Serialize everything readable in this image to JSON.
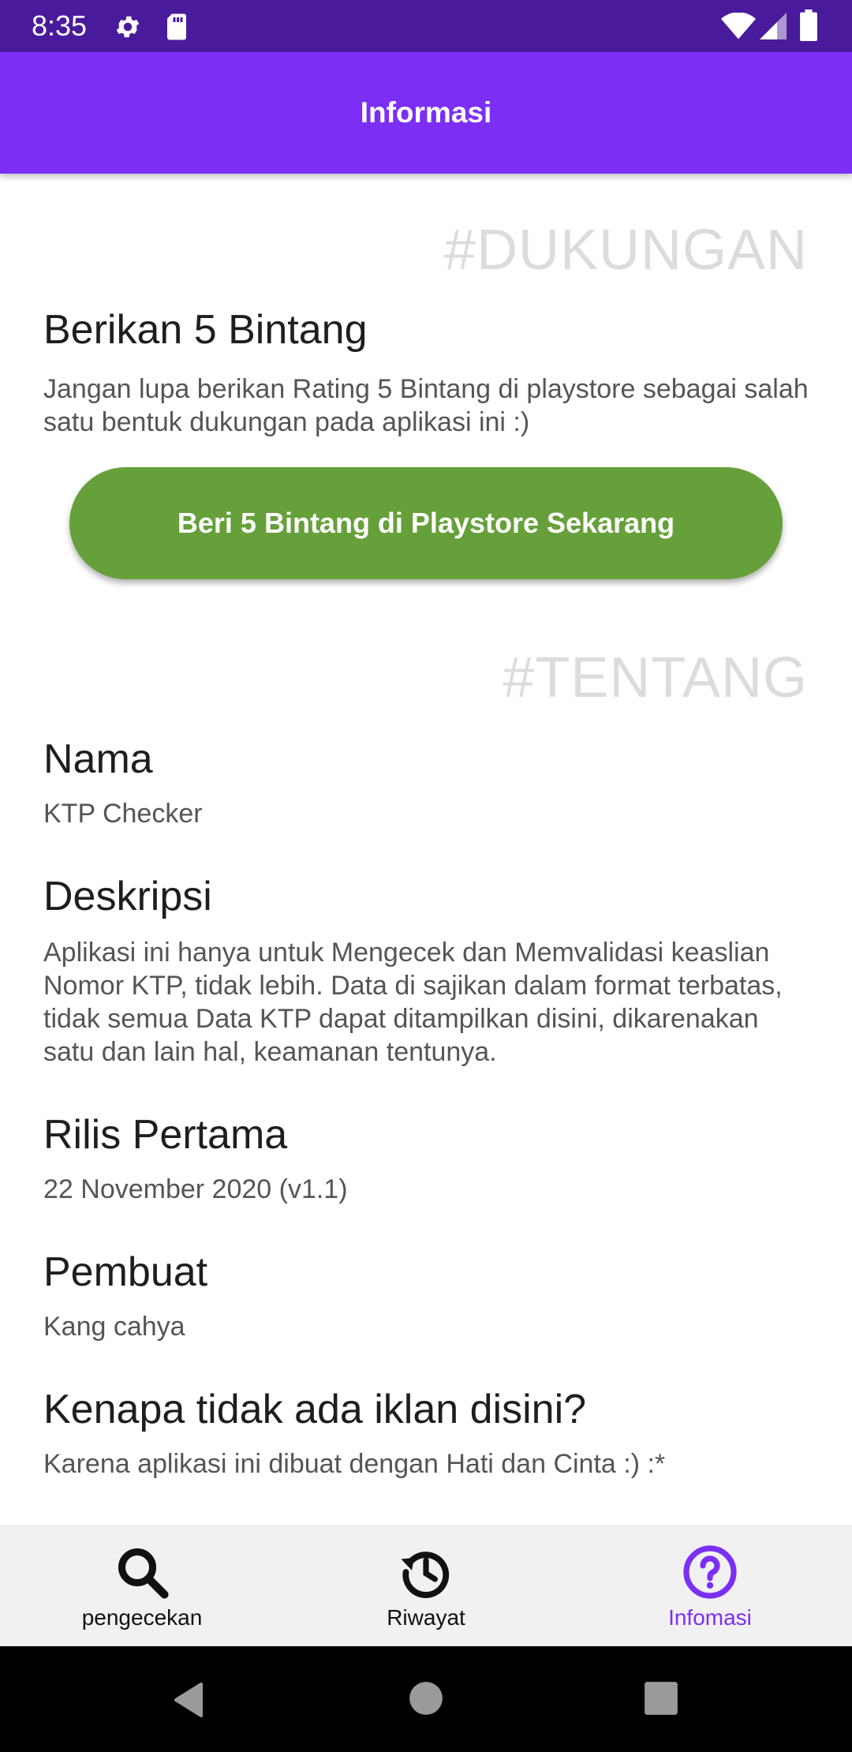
{
  "status_bar": {
    "time": "8:35",
    "icons": [
      "gear-icon",
      "sd-card-icon",
      "wifi-icon",
      "signal-icon",
      "battery-icon"
    ]
  },
  "app_bar": {
    "title": "Informasi",
    "color": "#7c2ef5"
  },
  "dukungan": {
    "tag": "#DUKUNGAN",
    "title": "Berikan 5 Bintang",
    "description": "Jangan lupa berikan Rating 5 Bintang di playstore sebagai salah satu bentuk dukungan pada aplikasi ini :)",
    "button_label": "Beri 5 Bintang di Playstore Sekarang",
    "button_color": "#66a03a"
  },
  "tentang": {
    "tag": "#TENTANG",
    "items": [
      {
        "title": "Nama",
        "value": "KTP Checker"
      },
      {
        "title": "Deskripsi",
        "value": "Aplikasi ini hanya untuk Mengecek dan Memvalidasi keaslian Nomor KTP, tidak lebih. Data di sajikan dalam format terbatas, tidak semua Data KTP dapat ditampilkan disini, dikarenakan satu dan lain hal, keamanan tentunya."
      },
      {
        "title": "Rilis Pertama",
        "value": "22 November 2020 (v1.1)"
      },
      {
        "title": "Pembuat",
        "value": "Kang cahya"
      },
      {
        "title": "Kenapa tidak ada iklan disini?",
        "value": "Karena aplikasi ini dibuat dengan Hati dan Cinta :) :*"
      }
    ]
  },
  "bottom_nav": {
    "items": [
      {
        "label": "pengecekan",
        "icon": "search-icon",
        "active": false
      },
      {
        "label": "Riwayat",
        "icon": "history-icon",
        "active": false
      },
      {
        "label": "Infomasi",
        "icon": "help-circle-icon",
        "active": true
      }
    ],
    "active_color": "#7c2ef5"
  },
  "system_nav": {
    "icons": [
      "back-icon",
      "home-icon",
      "recents-icon"
    ]
  }
}
